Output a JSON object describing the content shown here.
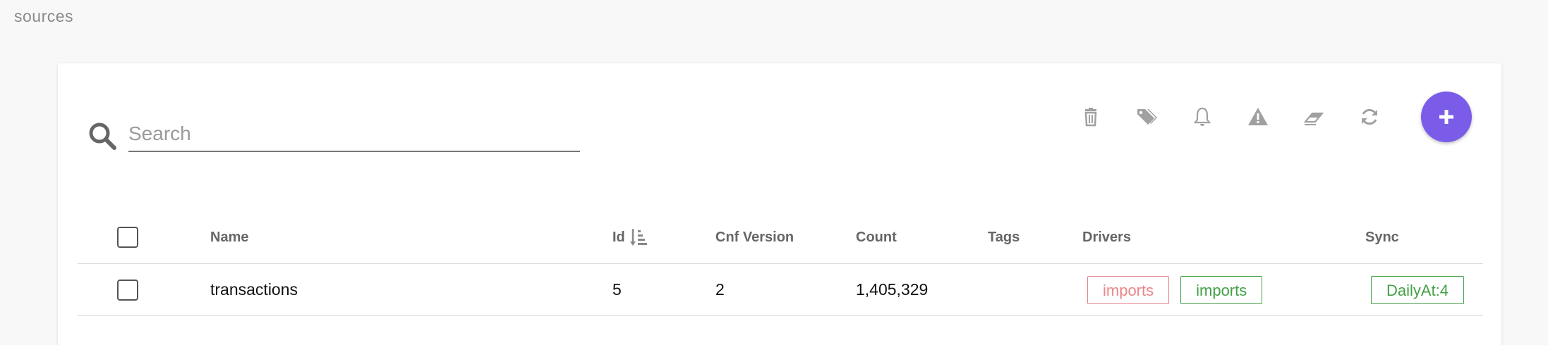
{
  "page": {
    "title": "sources"
  },
  "search": {
    "placeholder": "Search",
    "value": ""
  },
  "toolbar": {
    "icons": [
      "trash-icon",
      "tags-icon",
      "bell-icon",
      "warning-icon",
      "eraser-icon",
      "refresh-icon",
      "plus-icon"
    ],
    "fab_color": "#7b5ce9"
  },
  "table": {
    "headers": {
      "name": "Name",
      "id": "Id",
      "cnf_version": "Cnf Version",
      "count": "Count",
      "tags": "Tags",
      "drivers": "Drivers",
      "sync": "Sync"
    },
    "sort": {
      "column": "id",
      "direction": "ascending"
    },
    "rows": [
      {
        "name": "transactions",
        "id": "5",
        "cnf_version": "2",
        "count": "1,405,329",
        "tags": "",
        "drivers": [
          {
            "label": "imports",
            "color": "#e8868a"
          },
          {
            "label": "imports",
            "color": "#43a047"
          }
        ],
        "sync": "DailyAt:4"
      }
    ]
  },
  "colors": {
    "accent": "#7b5ce9",
    "chip_red": "#e8868a",
    "chip_green": "#43a047"
  }
}
